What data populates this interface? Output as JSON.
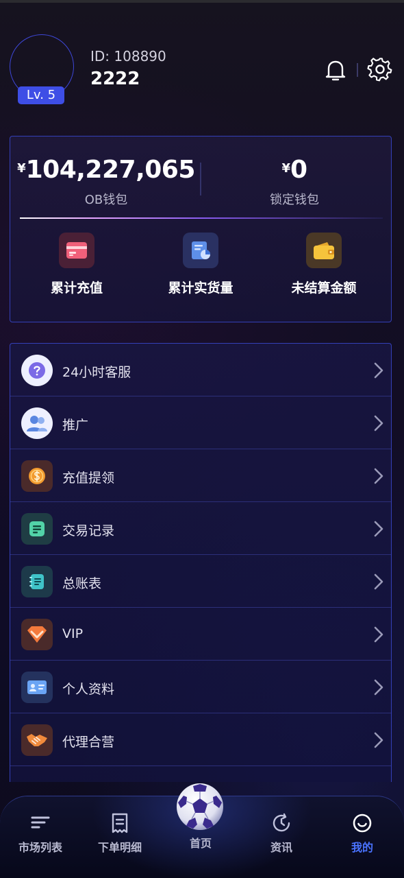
{
  "profile": {
    "id_text": "ID: 108890",
    "name": "2222",
    "level": "Lv. 5"
  },
  "wallet": {
    "currency_symbol": "¥",
    "ob_balance": "104,227,065",
    "ob_label": "OB钱包",
    "locked_balance": "0",
    "locked_label": "锁定钱包",
    "stats": [
      {
        "label": "累计充值",
        "icon": "card-icon"
      },
      {
        "label": "累计实货量",
        "icon": "report-chart-icon"
      },
      {
        "label": "未结算金额",
        "icon": "wallet-icon"
      }
    ]
  },
  "menu": {
    "items": [
      {
        "label": "24小时客服",
        "icon": "question-icon"
      },
      {
        "label": "推广",
        "icon": "users-icon"
      },
      {
        "label": "充值提领",
        "icon": "coin-icon"
      },
      {
        "label": "交易记录",
        "icon": "record-icon"
      },
      {
        "label": "总账表",
        "icon": "ledger-icon"
      },
      {
        "label": "VIP",
        "icon": "vip-diamond-icon"
      },
      {
        "label": "个人资料",
        "icon": "id-card-icon"
      },
      {
        "label": "代理合营",
        "icon": "handshake-icon"
      }
    ]
  },
  "tabbar": {
    "tabs": [
      {
        "label": "市场列表",
        "icon": "list-icon"
      },
      {
        "label": "下单明细",
        "icon": "receipt-icon"
      },
      {
        "label": "首页",
        "icon": "soccer-ball-icon"
      },
      {
        "label": "资讯",
        "icon": "clock-refresh-icon"
      },
      {
        "label": "我的",
        "icon": "smile-icon"
      }
    ],
    "active_index": 4
  },
  "colors": {
    "accent": "#4a73ff",
    "card_border": "#3440b8",
    "level_badge": "#3e4ee6"
  }
}
